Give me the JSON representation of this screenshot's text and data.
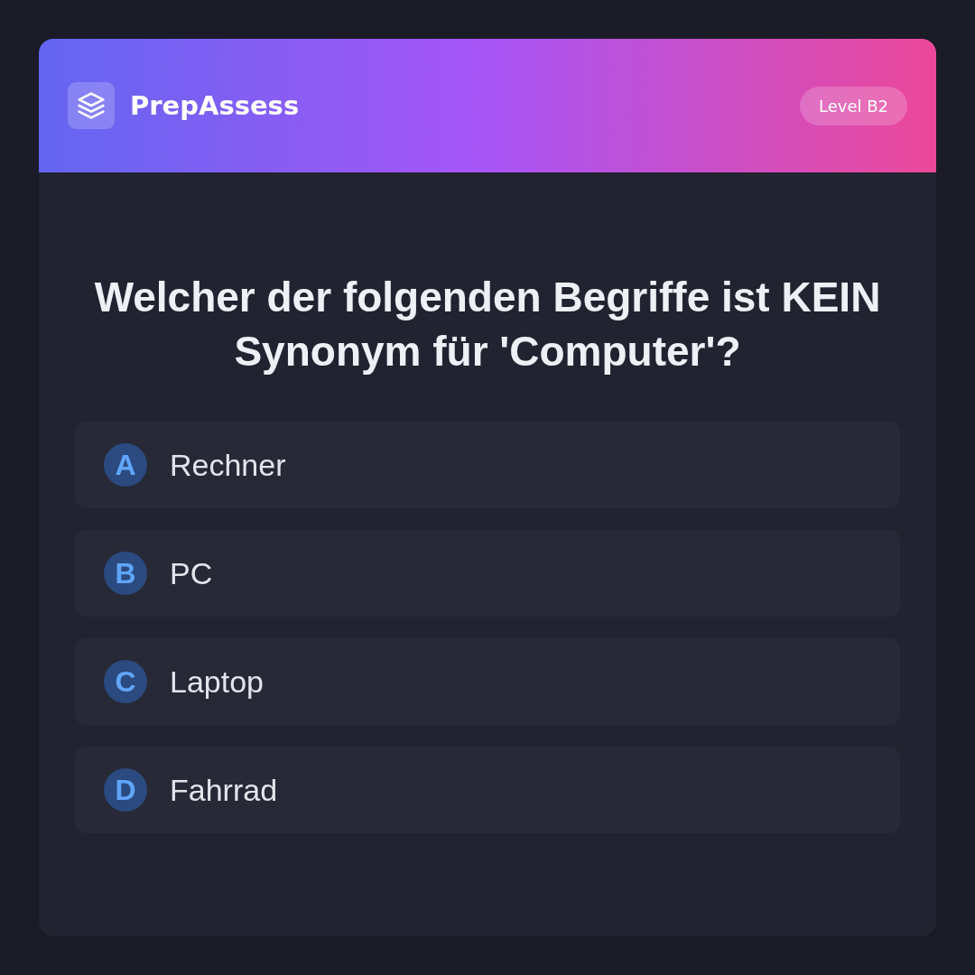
{
  "header": {
    "brand": "PrepAssess",
    "badge": "Level B2"
  },
  "question": "Welcher der folgenden Begriffe ist KEIN Synonym für 'Computer'?",
  "options": [
    {
      "letter": "A",
      "text": "Rechner"
    },
    {
      "letter": "B",
      "text": "PC"
    },
    {
      "letter": "C",
      "text": "Laptop"
    },
    {
      "letter": "D",
      "text": "Fahrrad"
    }
  ]
}
